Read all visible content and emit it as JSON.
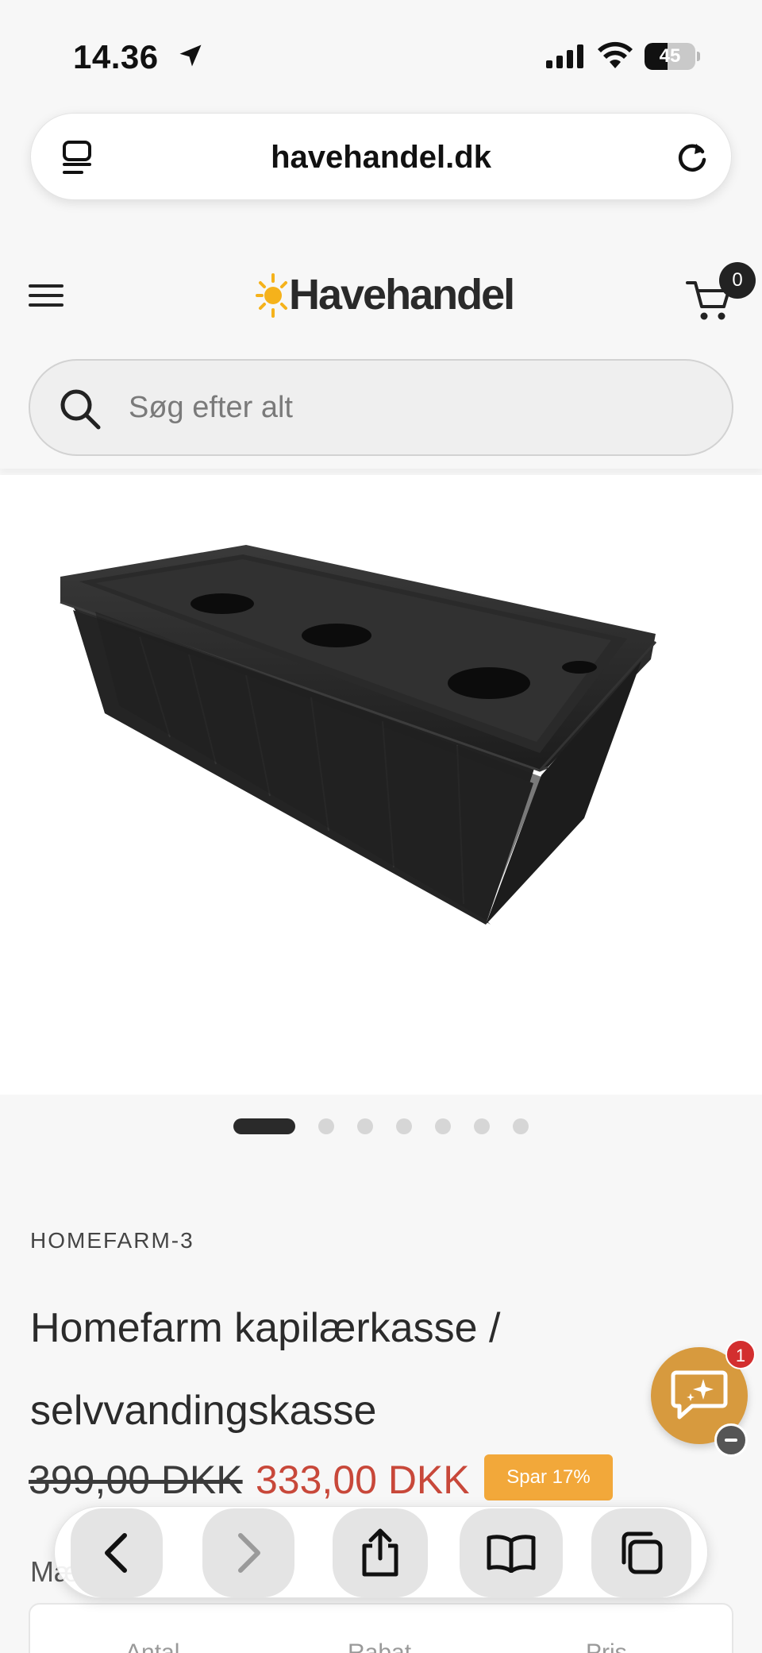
{
  "status_bar": {
    "time": "14.36",
    "battery": "45",
    "battery_level": 0.45
  },
  "browser": {
    "url": "havehandel.dk"
  },
  "header": {
    "logo_text": "Havehandel",
    "cart_count": "0",
    "search_placeholder": "Søg efter alt"
  },
  "gallery": {
    "total_images": 7,
    "active_index": 0
  },
  "product": {
    "sku": "HOMEFARM-3",
    "title": "Homefarm kapilærkasse / selvvandingskasse",
    "price_old": "399,00 DKK",
    "price_new": "333,00 DKK",
    "save_badge": "Spar 17%",
    "quantity_label": "Mængde",
    "table_headers": [
      "Antal",
      "Rabat",
      "Pris"
    ]
  },
  "chat": {
    "badge_count": "1"
  },
  "colors": {
    "accent_price": "#c8483a",
    "save_badge_bg": "#f2a83a",
    "chat_bg": "#d79a3e",
    "logo_sun": "#f5b21b"
  },
  "icons": {
    "location": "location-arrow-icon",
    "signal": "cellular-signal-icon",
    "wifi": "wifi-icon",
    "battery": "battery-icon",
    "reader": "reader-mode-icon",
    "reload": "reload-icon",
    "menu": "hamburger-menu-icon",
    "cart": "shopping-cart-icon",
    "search": "search-icon",
    "chat": "chat-sparkle-icon",
    "back": "chevron-left-icon",
    "forward": "chevron-right-icon",
    "share": "share-icon",
    "bookmarks": "book-icon",
    "tabs": "tabs-icon"
  }
}
